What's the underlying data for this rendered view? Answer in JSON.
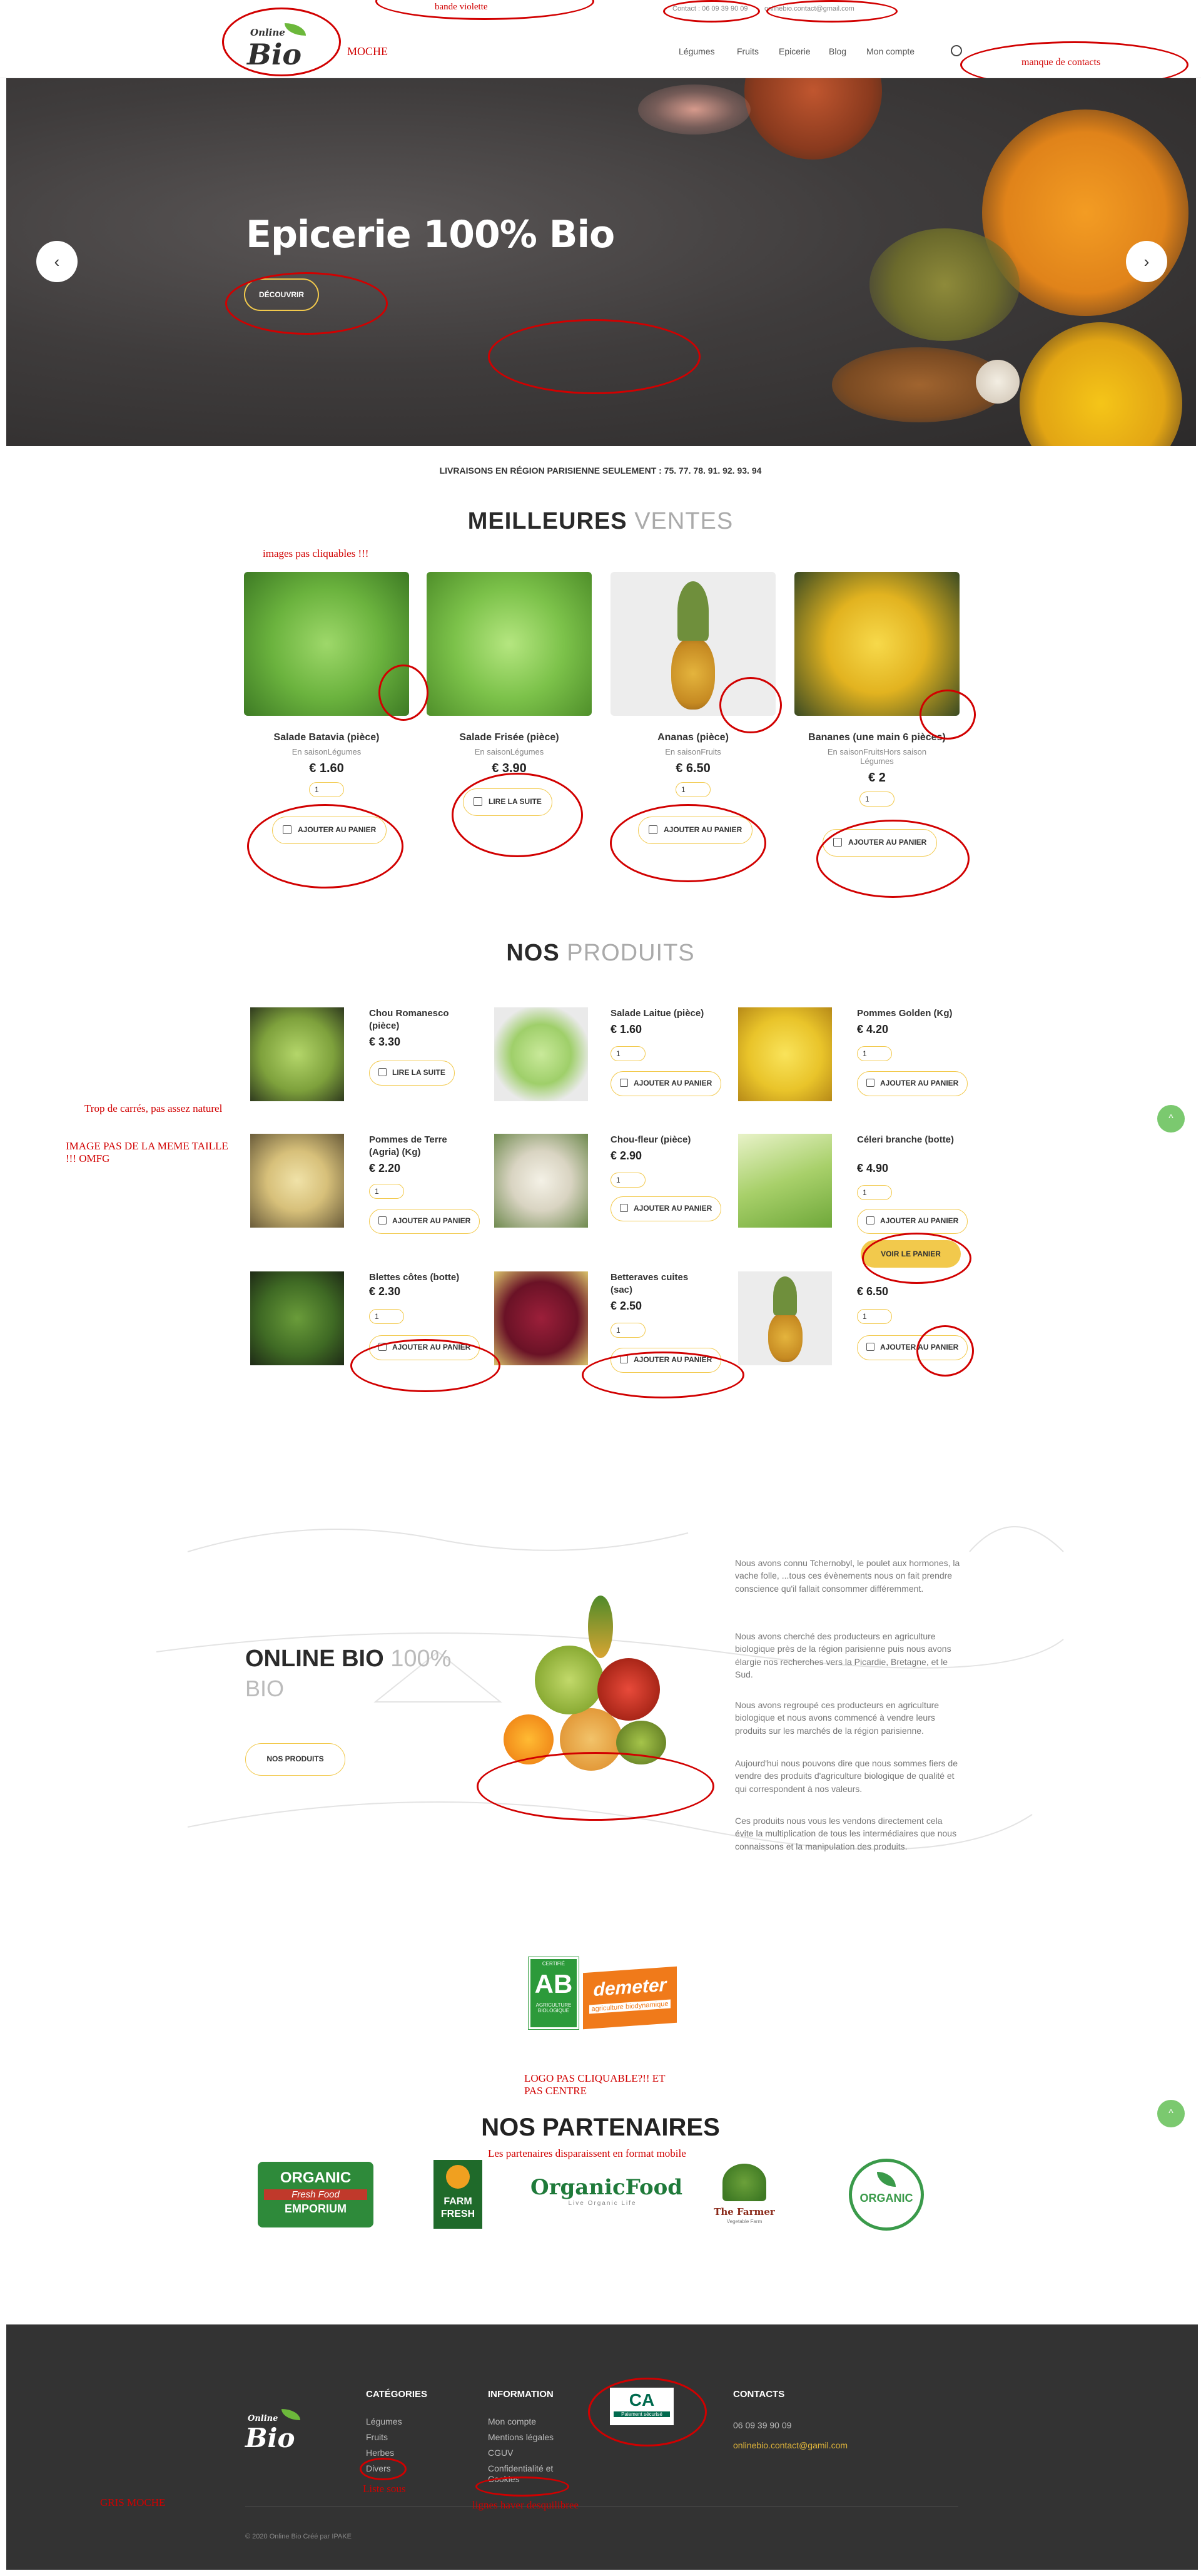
{
  "header": {
    "logo_top": "Online",
    "logo_main": "Bio",
    "contact_phone": "Contact : 06 09 39 90 09",
    "contact_email": "onlinebio.contact@gmail.com",
    "nav": [
      "Légumes",
      "Fruits",
      "Epicerie",
      "Blog",
      "Mon compte"
    ]
  },
  "annotations": {
    "bande_violette": "bande violette",
    "moche": "MOCHE",
    "manque_contacts": "manque de contacts",
    "trop_carres": "Trop de carrés, pas assez naturel",
    "image_taille": "IMAGE PAS DE LA MEME TAILLE !!! OMFG",
    "images_pas_cliquables": "images pas cliquables !!!",
    "logo_pas_cliquable": "LOGO PAS CLIQUABLE?!! ET PAS CENTRE",
    "partenaires_mobile": "Les partenaires disparaissent en format mobile",
    "gris_moche": "GRIS MOCHE",
    "liste_sous": "Liste sous",
    "lignes": "lignes haver desquilibree"
  },
  "hero": {
    "title_light": "Epicerie ",
    "title_bold": "100% Bio",
    "button": "DÉCOUVRIR"
  },
  "delivery_notice": "LIVRAISONS EN RÉGION PARISIENNE SEULEMENT : 75. 77. 78. 91. 92. 93. 94",
  "best_sellers": {
    "title_bold": "MEILLEURES",
    "title_light": " VENTES",
    "products": [
      {
        "name": "Salade Batavia (pièce)",
        "category": "En saisonLégumes",
        "price": "€ 1.60",
        "button": "AJOUTER AU PANIER",
        "has_qty": true
      },
      {
        "name": "Salade Frisée (pièce)",
        "category": "En saisonLégumes",
        "price": "€ 3.90",
        "button": "LIRE LA SUITE",
        "has_qty": false
      },
      {
        "name": "Ananas (pièce)",
        "category": "En saisonFruits",
        "price": "€ 6.50",
        "button": "AJOUTER AU PANIER",
        "has_qty": true
      },
      {
        "name": "Bananes (une main 6 pièces)",
        "category": "En saisonFruitsHors saison Légumes",
        "price": "€ 2",
        "button": "AJOUTER AU PANIER",
        "has_qty": true
      }
    ]
  },
  "our_products": {
    "title_bold": "NOS",
    "title_light": " PRODUITS",
    "items": [
      {
        "name": "Chou Romanesco (pièce)",
        "price": "€ 3.30",
        "button": "LIRE LA SUITE",
        "has_qty": false
      },
      {
        "name": "Salade Laitue (pièce)",
        "price": "€ 1.60",
        "button": "AJOUTER AU PANIER",
        "has_qty": true
      },
      {
        "name": "Pommes Golden (Kg)",
        "price": "€ 4.20",
        "button": "AJOUTER AU PANIER",
        "has_qty": true
      },
      {
        "name": "Pommes de Terre (Agria) (Kg)",
        "price": "€ 2.20",
        "button": "AJOUTER AU PANIER",
        "has_qty": true
      },
      {
        "name": "Chou-fleur (pièce)",
        "price": "€ 2.90",
        "button": "AJOUTER AU PANIER",
        "has_qty": true
      },
      {
        "name": "Céleri branche (botte)",
        "price": "€ 4.90",
        "button": "AJOUTER AU PANIER",
        "has_qty": true
      },
      {
        "name": "Blettes côtes (botte)",
        "price": "€ 2.30",
        "button": "AJOUTER AU PANIER",
        "has_qty": true
      },
      {
        "name": "Betteraves cuites (sac)",
        "price": "€ 2.50",
        "button": "AJOUTER AU PANIER",
        "has_qty": true
      },
      {
        "name": "",
        "price": "€ 6.50",
        "button": "AJOUTER AU PANIER",
        "has_qty": true
      }
    ],
    "voir_panier": "VOIR LE PANIER"
  },
  "about": {
    "title_bold": "ONLINE BIO",
    "title_light": " 100%",
    "title_line2": "BIO",
    "button": "NOS PRODUITS",
    "paragraphs": [
      "Nous avons connu Tchernobyl, le poulet aux hormones, la vache folle, ...tous ces évènements nous on fait prendre conscience qu'il fallait consommer différemment.",
      "Nous avons cherché des producteurs en agriculture biologique près de la région parisienne puis nous avons élargie nos recherches vers la Picardie, Bretagne, et le Sud.",
      "Nous avons regroupé ces producteurs en agriculture biologique et nous avons commencé à vendre leurs produits sur les marchés de la région parisienne.",
      "Aujourd'hui nous pouvons dire que nous sommes fiers de vendre des produits d'agriculture biologique de qualité et qui correspondent à nos valeurs.",
      "Ces produits nous vous les vendons directement cela évite la multiplication de tous les intermédiaires que nous connaissons et la manipulation des produits."
    ]
  },
  "certifications": {
    "ab_top": "CERTIFIÉ",
    "ab_main": "AB",
    "ab_bottom": "AGRICULTURE BIOLOGIQUE",
    "demeter": "demeter",
    "demeter_sub": "agriculture biodynamique"
  },
  "partners": {
    "title": "NOS PARTENAIRES",
    "logos": [
      {
        "line1": "ORGANIC",
        "line2": "Fresh Food",
        "line3": "EMPORIUM"
      },
      {
        "line1": "FARM",
        "line2": "FRESH"
      },
      {
        "line1": "OrganicFood",
        "line2": "Live Organic Life"
      },
      {
        "line1": "The Farmer",
        "line2": "Vegetable Farm"
      },
      {
        "line1": "ORGANIC"
      }
    ]
  },
  "footer": {
    "categories_title": "CATÉGORIES",
    "categories": [
      "Légumes",
      "Fruits",
      "Herbes",
      "Divers"
    ],
    "information_title": "INFORMATION",
    "information": [
      "Mon compte",
      "Mentions légales",
      "CGUV",
      "Confidentialité et Cookies"
    ],
    "bank_name": "CA",
    "bank_sub": "Paiement sécurisé",
    "contacts_title": "CONTACTS",
    "phone": "06 09 39 90 09",
    "email": "onlinebio.contact@gamil.com",
    "copyright": "© 2020 Online Bio Créé par IPAKE"
  },
  "colors": {
    "accent": "#f2c94c",
    "green": "#6cb83b",
    "footer_bg": "#333333",
    "annotation": "#d10000"
  }
}
